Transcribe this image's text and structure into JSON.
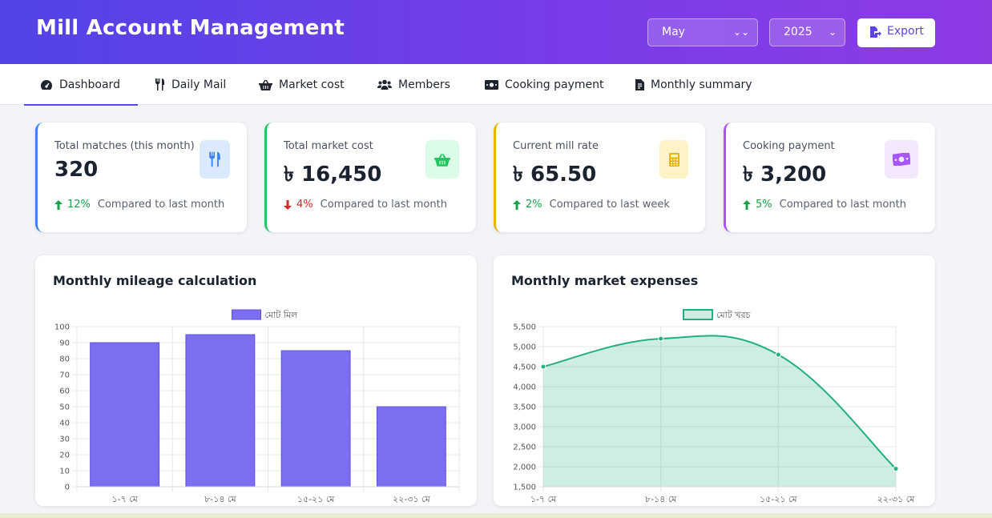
{
  "header": {
    "title": "Mill Account Management",
    "month_select": "May",
    "year_select": "2025",
    "export_label": "Export"
  },
  "nav": {
    "tabs": [
      {
        "label": "Dashboard",
        "icon": "gauge-icon",
        "active": true
      },
      {
        "label": "Daily Mail",
        "icon": "utensils-icon",
        "active": false
      },
      {
        "label": "Market cost",
        "icon": "basket-icon",
        "active": false
      },
      {
        "label": "Members",
        "icon": "users-icon",
        "active": false
      },
      {
        "label": "Cooking payment",
        "icon": "money-bill-icon",
        "active": false
      },
      {
        "label": "Monthly summary",
        "icon": "file-invoice-icon",
        "active": false
      }
    ]
  },
  "stats": [
    {
      "label": "Total matches (this month)",
      "value": "320",
      "pct": "12%",
      "direction": "up",
      "compare": "Compared to last month",
      "accent": "#3b82f6",
      "icon": "utensils-icon",
      "icon_bg": "#dbeafe",
      "icon_color": "#3b82f6"
    },
    {
      "label": "Total market cost",
      "value": "৳ 16,450",
      "pct": "4%",
      "direction": "down",
      "compare": "Compared to last month",
      "accent": "#22c55e",
      "icon": "basket-icon",
      "icon_bg": "#dcfce7",
      "icon_color": "#22c55e"
    },
    {
      "label": "Current mill rate",
      "value": "৳ 65.50",
      "pct": "2%",
      "direction": "up",
      "compare": "Compared to last week",
      "accent": "#eab308",
      "icon": "calculator-icon",
      "icon_bg": "#fef3c7",
      "icon_color": "#eab308"
    },
    {
      "label": "Cooking payment",
      "value": "৳ 3,200",
      "pct": "5%",
      "direction": "up",
      "compare": "Compared to last month",
      "accent": "#a855f7",
      "icon": "money-bill-icon",
      "icon_bg": "#f3e8ff",
      "icon_color": "#a855f7"
    }
  ],
  "charts": {
    "mileage_title": "Monthly mileage calculation",
    "market_title": "Monthly market expenses"
  },
  "chart_data": [
    {
      "type": "bar",
      "title": "Monthly mileage calculation",
      "categories": [
        "১-৭ মে",
        "৮-১৪ মে",
        "১৫-২১ মে",
        "২২-৩১ মে"
      ],
      "series": [
        {
          "name": "মোট মিল",
          "values": [
            90,
            95,
            85,
            50
          ]
        }
      ],
      "ylim": [
        0,
        100
      ],
      "yticks": [
        "0",
        "10",
        "20",
        "30",
        "40",
        "50",
        "60",
        "70",
        "80",
        "90",
        "100"
      ],
      "grid": true,
      "legend": "top-center",
      "color": "#7b6ff0"
    },
    {
      "type": "area",
      "title": "Monthly market expenses",
      "categories": [
        "১-৭ মে",
        "৮-১৪ মে",
        "১৫-২১ মে",
        "২২-৩১ মে"
      ],
      "series": [
        {
          "name": "মোট খরচ",
          "values": [
            4500,
            5200,
            4800,
            1950
          ]
        }
      ],
      "ylim": [
        1500,
        5500
      ],
      "yticks": [
        "1,500",
        "2,000",
        "2,500",
        "3,000",
        "3,500",
        "4,000",
        "4,500",
        "5,000",
        "5,500"
      ],
      "grid": true,
      "legend": "top-center",
      "color": "#22b07d"
    }
  ]
}
